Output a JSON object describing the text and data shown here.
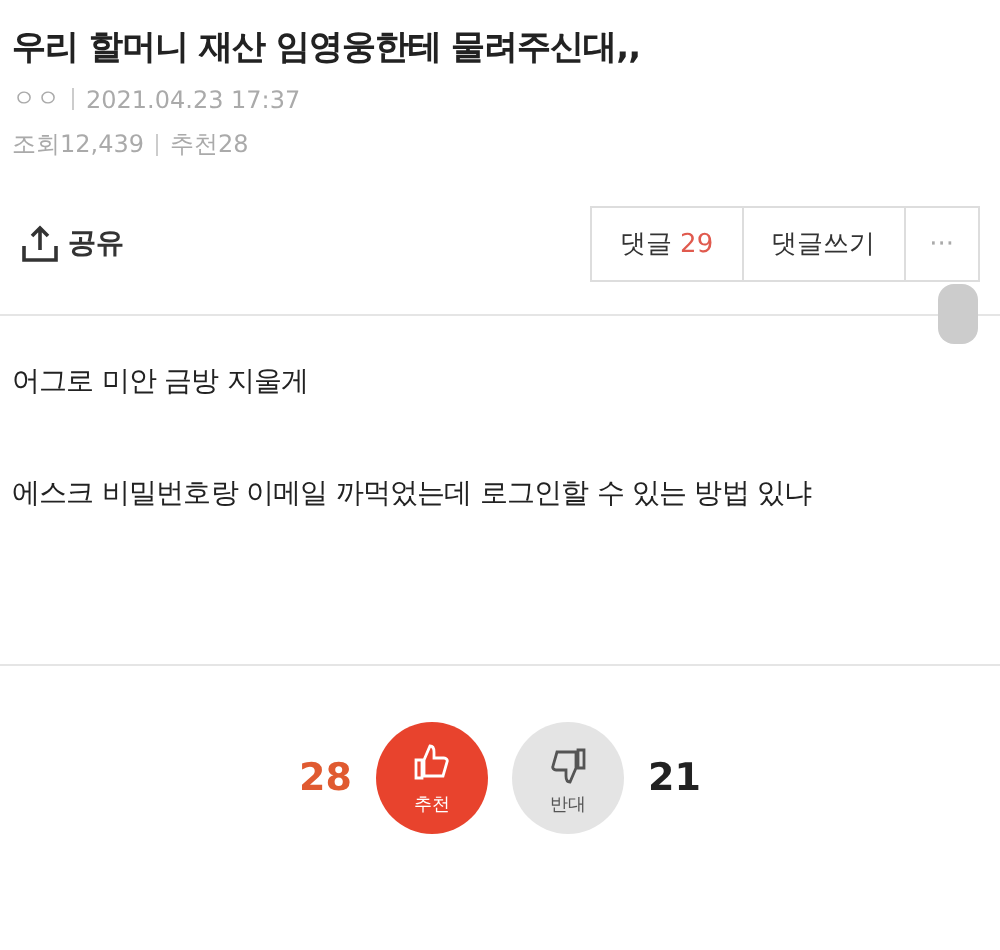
{
  "post": {
    "title": "우리 할머니 재산 임영웅한테 물려주신대,,",
    "author": "ㅇㅇ",
    "date": "2021.04.23 17:37",
    "views": "조회12,439",
    "recommends": "추천28"
  },
  "toolbar": {
    "share": "공유",
    "comments_label": "댓글",
    "comments_count": "29",
    "write_comment": "댓글쓰기",
    "more": "···"
  },
  "body": [
    "어그로 미안 금방 지울게",
    "에스크 비밀번호랑 이메일 까먹었는데 로그인할 수 있는 방법 있냐"
  ],
  "votes": [
    {
      "kind": "up",
      "count": "28",
      "label": "추천",
      "color": "#e8432d"
    },
    {
      "kind": "down",
      "count": "21",
      "label": "반대",
      "color": "#e4e4e4"
    }
  ]
}
